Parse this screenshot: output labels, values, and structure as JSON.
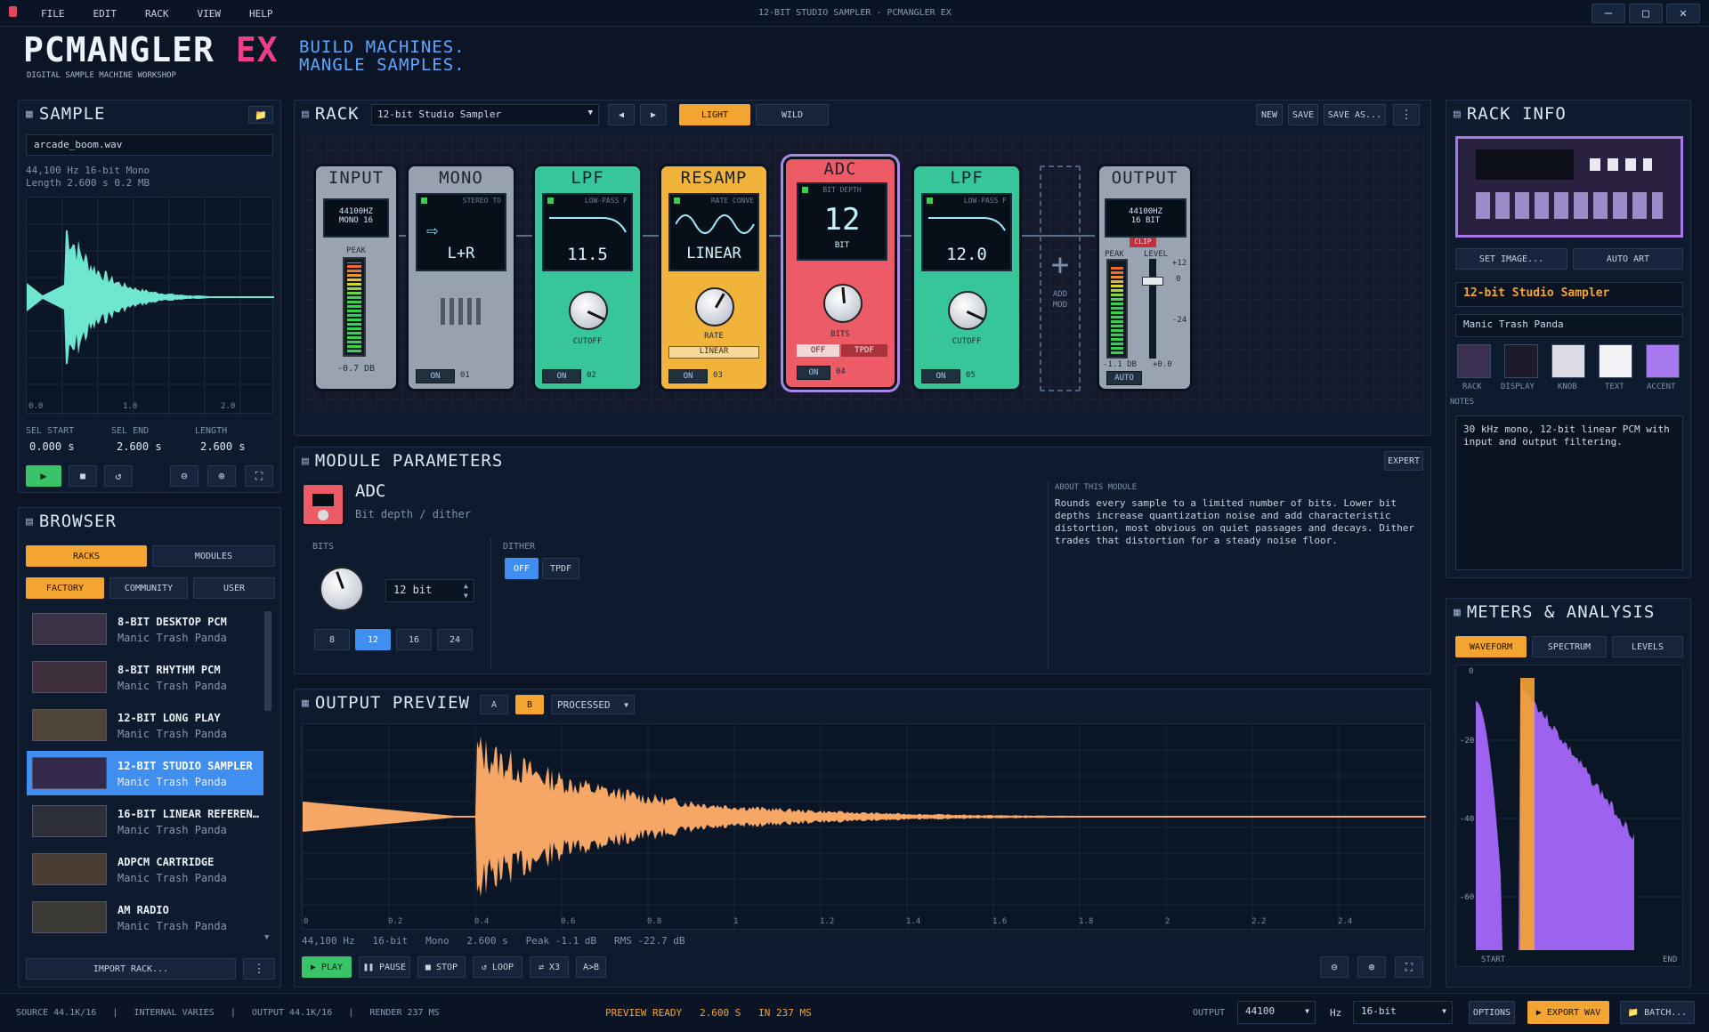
{
  "window": {
    "title": "12-BIT STUDIO SAMPLER - PCMANGLER EX",
    "menu": [
      "FILE",
      "EDIT",
      "RACK",
      "VIEW",
      "HELP"
    ]
  },
  "brand": {
    "logo_main": "PCMANGLER",
    "logo_ex": "EX",
    "subtitle": "DIGITAL SAMPLE MACHINE WORKSHOP",
    "tag1": "BUILD MACHINES.",
    "tag2": "MANGLE SAMPLES."
  },
  "sample": {
    "title": "SAMPLE",
    "file": "arcade_boom.wav",
    "info1": "44,100 Hz   16-bit   Mono",
    "info2": "Length 2.600 s   0.2 MB",
    "ticks": [
      "0.0",
      "1.0",
      "2.0"
    ],
    "sel_start_label": "SEL START",
    "sel_end_label": "SEL END",
    "length_label": "LENGTH",
    "sel_start": "0.000 s",
    "sel_end": "2.600 s",
    "length": "2.600 s"
  },
  "browser": {
    "title": "BROWSER",
    "tab_racks": "RACKS",
    "tab_modules": "MODULES",
    "sub_factory": "FACTORY",
    "sub_community": "COMMUNITY",
    "sub_user": "USER",
    "items": [
      {
        "name": "8-BIT DESKTOP PCM",
        "author": "Manic Trash Panda"
      },
      {
        "name": "8-BIT RHYTHM PCM",
        "author": "Manic Trash Panda"
      },
      {
        "name": "12-BIT LONG PLAY",
        "author": "Manic Trash Panda"
      },
      {
        "name": "12-BIT STUDIO SAMPLER",
        "author": "Manic Trash Panda"
      },
      {
        "name": "16-BIT LINEAR REFEREN…",
        "author": "Manic Trash Panda"
      },
      {
        "name": "ADPCM CARTRIDGE",
        "author": "Manic Trash Panda"
      },
      {
        "name": "AM RADIO",
        "author": "Manic Trash Panda"
      }
    ],
    "import": "IMPORT RACK..."
  },
  "rack": {
    "title": "RACK",
    "preset": "12-bit Studio Sampler",
    "light": "LIGHT",
    "wild": "WILD",
    "new": "NEW",
    "save": "SAVE",
    "save_as": "SAVE AS...",
    "input": {
      "name": "INPUT",
      "lcd1": "44100HZ",
      "lcd2": "MONO 16",
      "peak": "PEAK",
      "db": "-0.7 DB"
    },
    "mono": {
      "name": "MONO",
      "caption": "STEREO TO",
      "value": "L+R",
      "on": "ON",
      "num": "01"
    },
    "lpf1": {
      "name": "LPF",
      "caption": "LOW-PASS F",
      "value": "11.5",
      "knob": "CUTOFF",
      "on": "ON",
      "num": "02"
    },
    "resamp": {
      "name": "RESAMP",
      "caption": "RATE CONVE",
      "value": "LINEAR",
      "knob": "RATE",
      "select": "LINEAR",
      "on": "ON",
      "num": "03"
    },
    "adc": {
      "name": "ADC",
      "caption": "BIT DEPTH",
      "value": "12",
      "unit": "BIT",
      "knob": "BITS",
      "off": "OFF",
      "tpdf": "TPDF",
      "on": "ON",
      "num": "04"
    },
    "lpf2": {
      "name": "LPF",
      "caption": "LOW-PASS F",
      "value": "12.0",
      "knob": "CUTOFF",
      "on": "ON",
      "num": "05"
    },
    "add": {
      "line1": "ADD",
      "line2": "MOD"
    },
    "output": {
      "name": "OUTPUT",
      "lcd1": "44100HZ",
      "lcd2": "16 BIT",
      "clip": "CLIP",
      "peak": "PEAK",
      "level": "LEVEL",
      "s1": "+12",
      "s2": "0",
      "s3": "-24",
      "db": "-1.1 DB",
      "plus": "+0.0",
      "auto": "AUTO"
    }
  },
  "params": {
    "title": "MODULE PARAMETERS",
    "expert": "EXPERT",
    "mod_name": "ADC",
    "mod_desc": "Bit depth / dither",
    "bits_label": "BITS",
    "bits_value": "12 bit",
    "bit_opts": [
      "8",
      "12",
      "16",
      "24"
    ],
    "dither_label": "DITHER",
    "dither_off": "OFF",
    "dither_tpdf": "TPDF",
    "about_label": "ABOUT THIS MODULE",
    "about_text": "Rounds every sample to a limited number of bits. Lower bit depths increase quantization noise and add characteristic distortion, most obvious on quiet passages and decays. Dither trades that distortion for a steady noise floor."
  },
  "preview": {
    "title": "OUTPUT PREVIEW",
    "a": "A",
    "b": "B",
    "mode": "PROCESSED",
    "ticks": [
      "0",
      "0.2",
      "0.4",
      "0.6",
      "0.8",
      "1",
      "1.2",
      "1.4",
      "1.6",
      "1.8",
      "2",
      "2.2",
      "2.4"
    ],
    "info": "44,100 Hz   16-bit   Mono   2.600 s   Peak -1.1 dB   RMS -22.7 dB",
    "play": "PLAY",
    "pause": "PAUSE",
    "stop": "STOP",
    "loop": "LOOP",
    "x3": "X3",
    "ab": "A>B"
  },
  "info": {
    "title": "RACK INFO",
    "set_image": "SET IMAGE...",
    "auto_art": "AUTO ART",
    "name": "12-bit Studio Sampler",
    "author": "Manic Trash Panda",
    "swatch_labels": [
      "RACK",
      "DISPLAY",
      "KNOB",
      "TEXT",
      "ACCENT"
    ],
    "swatch_colors": [
      "#3a3052",
      "#1d1a2c",
      "#dcdce6",
      "#f3f3f7",
      "#a979f0"
    ],
    "notes_label": "NOTES",
    "notes": "30 kHz mono, 12-bit linear PCM with input and output filtering."
  },
  "meters": {
    "title": "METERS & ANALYSIS",
    "tab1": "WAVEFORM",
    "tab2": "SPECTRUM",
    "tab3": "LEVELS",
    "yt": [
      "0",
      "-20",
      "-40",
      "-60"
    ],
    "start": "START",
    "end": "END"
  },
  "status": {
    "left": "SOURCE 44.1K/16   |   INTERNAL VARIES   |   OUTPUT 44.1K/16   |   RENDER 237 MS",
    "ready": "PREVIEW READY   2.600 S   IN 237 MS",
    "output_label": "OUTPUT",
    "rate": "44100",
    "hz": "Hz",
    "depth": "16-bit",
    "options": "OPTIONS",
    "export": "EXPORT WAV",
    "batch": "BATCH..."
  },
  "colors": {
    "accent": "#f3a431",
    "select": "#3f8ef0",
    "wave_src": "#6fe6cf",
    "wave_out": "#f7a765",
    "spectrum": "#9d62ee"
  }
}
